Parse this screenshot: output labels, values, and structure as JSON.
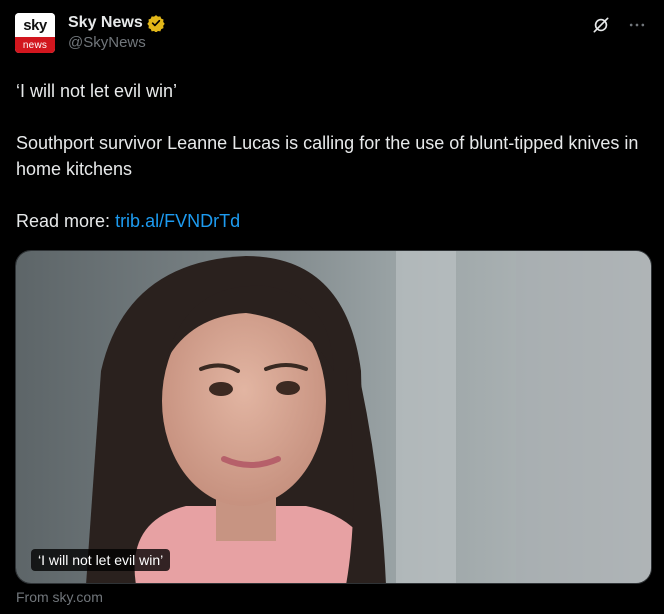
{
  "account": {
    "avatar_top": "sky",
    "avatar_bottom": "news",
    "display_name": "Sky News",
    "handle": "@SkyNews",
    "verified_color": "#e2b719"
  },
  "tweet": {
    "headline": "‘I will not let evil win’",
    "paragraph": "Southport survivor Leanne Lucas is calling for the use of blunt-tipped knives in home kitchens",
    "read_more_label": "Read more:",
    "link_text": "trib.al/FVNDrTd"
  },
  "media": {
    "caption": "‘I will not let evil win’",
    "source": "From sky.com"
  },
  "icons": {
    "grok": "grok-icon",
    "more": "more-icon",
    "verified": "verified-badge-icon"
  },
  "colors": {
    "background": "#000000",
    "text": "#e7e9ea",
    "secondary": "#71767b",
    "link": "#1d9bf0",
    "brand_red": "#d2161e"
  }
}
